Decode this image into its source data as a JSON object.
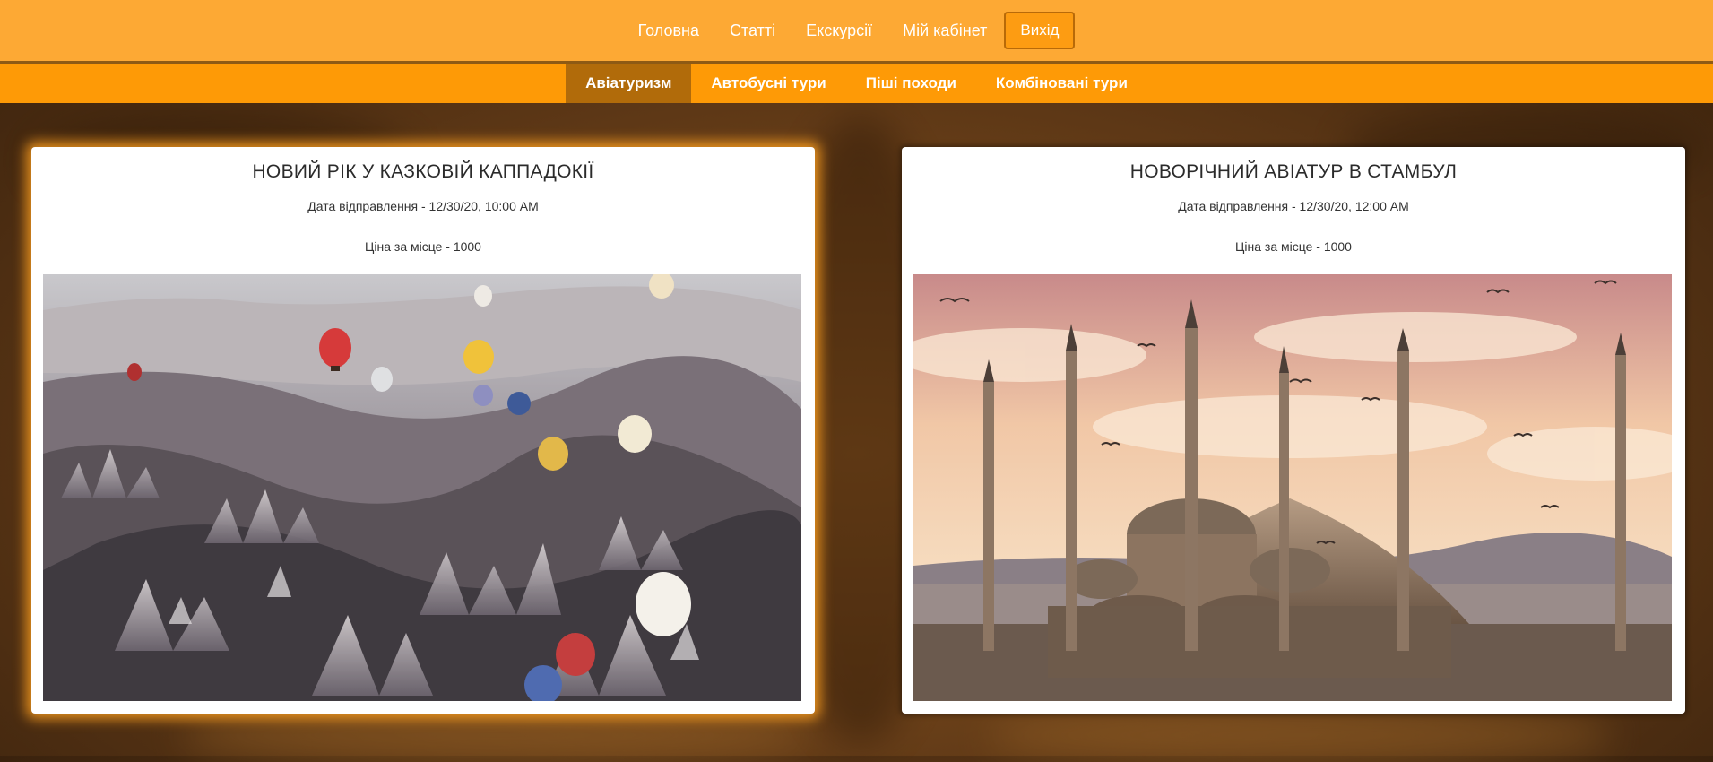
{
  "topnav": {
    "items": [
      {
        "label": "Головна"
      },
      {
        "label": "Статті"
      },
      {
        "label": "Екскурсії"
      },
      {
        "label": "Мій кабінет"
      }
    ],
    "logout_label": "Вихід"
  },
  "subnav": {
    "items": [
      {
        "label": "Авіатуризм",
        "active": true
      },
      {
        "label": "Автобусні тури",
        "active": false
      },
      {
        "label": "Піші походи",
        "active": false
      },
      {
        "label": "Комбіновані тури",
        "active": false
      }
    ]
  },
  "tours": [
    {
      "title": "НОВИЙ РІК У КАЗКОВІЙ КАППАДОКІЇ",
      "date": "Дата відправлення - 12/30/20, 10:00 AM",
      "price": "Ціна за місце - 1000",
      "image": "cappadocia-balloons-photo"
    },
    {
      "title": "НОВОРІЧНИЙ АВІАТУР В СТАМБУЛ",
      "date": "Дата відправлення - 12/30/20, 12:00 AM",
      "price": "Ціна за місце - 1000",
      "image": "istanbul-blue-mosque-photo"
    }
  ],
  "colors": {
    "topnav_bg": "#fda934",
    "subnav_bg": "#fe9a06",
    "subnav_active": "#b16b0a",
    "logout_border": "#b86a08"
  }
}
